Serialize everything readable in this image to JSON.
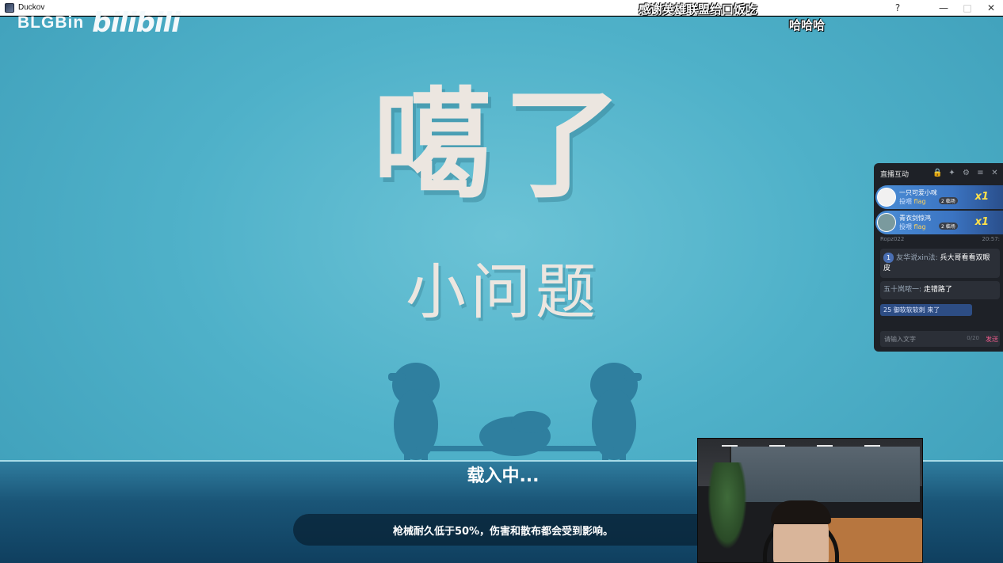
{
  "window": {
    "title": "Duckov",
    "help_glyph": "?",
    "minimize_glyph": "—",
    "maximize_glyph": "□",
    "close_glyph": "✕"
  },
  "brand": {
    "streamer": "BLGBin",
    "platform_logo": "bilibili"
  },
  "overlay": {
    "marquee": "感谢英雄联盟给口饭吃",
    "caption": "哈哈哈"
  },
  "game": {
    "title": "噶了",
    "subtitle": "小问题",
    "loading": "载入中...",
    "tip": "枪械耐久低于50%，伤害和散布都会受到影响。"
  },
  "chat": {
    "title": "直播互动",
    "icons": [
      "lock-icon",
      "sparkle-icon",
      "gear-icon",
      "shrink-icon",
      "close-icon"
    ],
    "gifts": [
      {
        "user": "一只可爱小咪",
        "action": "投喂",
        "item": "flag",
        "badge": "2 临场",
        "count": "x1"
      },
      {
        "user": "青衣剑惊鸿",
        "action": "投喂",
        "item": "flag",
        "badge": "2 临场",
        "count": "x1"
      }
    ],
    "meta_user": "Ropz022",
    "meta_time": "20:57:",
    "messages": [
      {
        "badge": "1",
        "user": "友华说xin法:",
        "text": "兵大哥看看双眼皮"
      },
      {
        "badge": "",
        "user": "五十岚哝一:",
        "text": "走错路了"
      }
    ],
    "entry": "25 御软软软刺 来了",
    "input_placeholder": "请输入文字",
    "input_counter": "0/20",
    "send_label": "发送"
  }
}
